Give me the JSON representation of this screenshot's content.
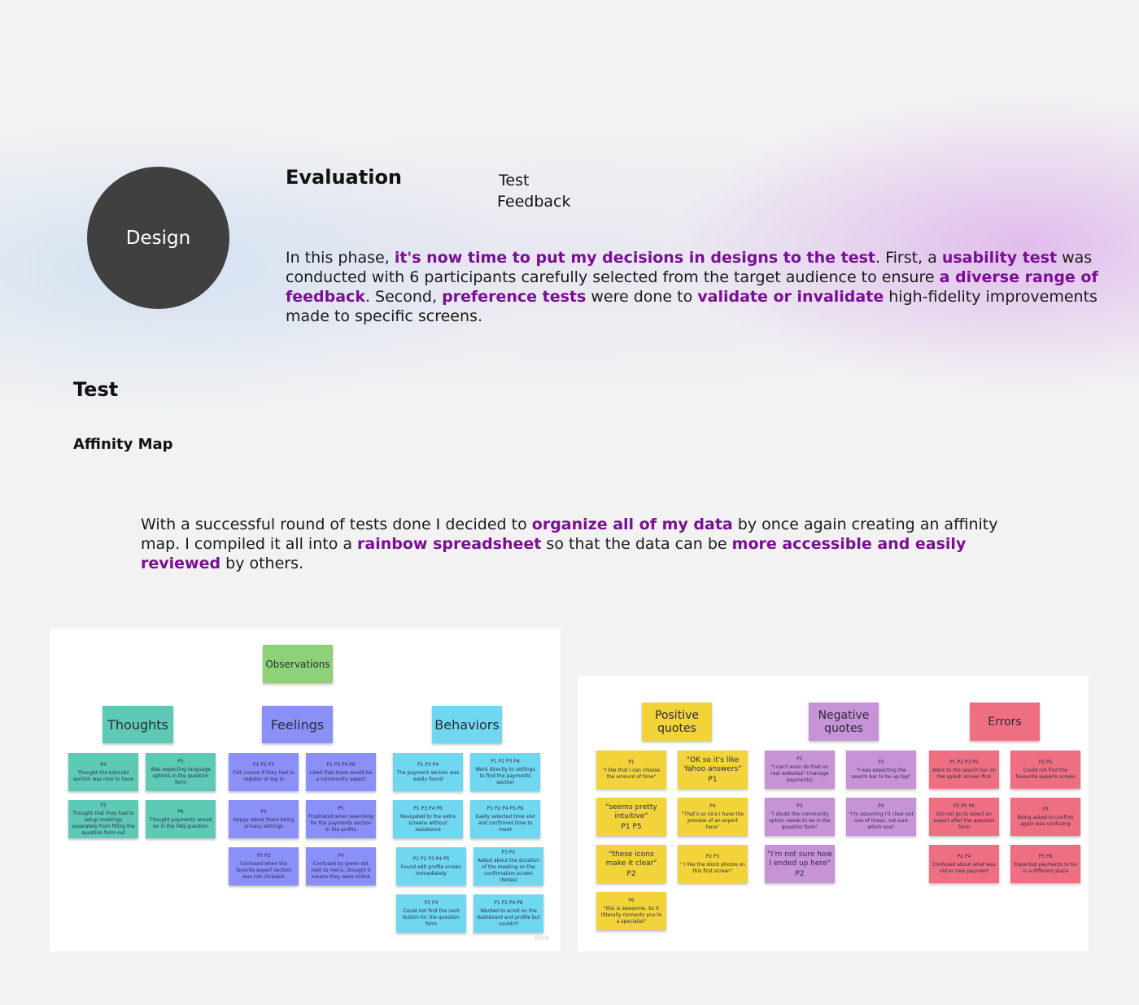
{
  "design_badge": "Design",
  "evaluation": {
    "title": "Evaluation",
    "tags": [
      "Test",
      "Feedback"
    ],
    "body": [
      {
        "text": "In this phase, ",
        "hl": false
      },
      {
        "text": "it's now time to put my decisions in designs to the test",
        "hl": true
      },
      {
        "text": ". First, a ",
        "hl": false
      },
      {
        "text": "usability test",
        "hl": true
      },
      {
        "text": " was conducted with 6 participants carefully selected from the target audience to ensure ",
        "hl": false
      },
      {
        "text": "a diverse range of feedback",
        "hl": true
      },
      {
        "text": ". Second, ",
        "hl": false
      },
      {
        "text": "preference tests",
        "hl": true
      },
      {
        "text": " were done to ",
        "hl": false
      },
      {
        "text": "validate or invalidate",
        "hl": true
      },
      {
        "text": " high-fidelity improvements made to specific screens.",
        "hl": false
      }
    ]
  },
  "test_title": "Test",
  "affinity": {
    "title": "Affinity Map",
    "body": [
      {
        "text": "With a successful round of tests done I decided to ",
        "hl": false
      },
      {
        "text": "organize all of my data",
        "hl": true
      },
      {
        "text": " by once again creating an affinity map. I compiled it all into a ",
        "hl": false
      },
      {
        "text": "rainbow spreadsheet",
        "hl": true
      },
      {
        "text": " so that the data can be ",
        "hl": false
      },
      {
        "text": "more accessible and easily reviewed",
        "hl": true
      },
      {
        "text": " by others.",
        "hl": false
      }
    ]
  },
  "observations_board": {
    "root": "Observations",
    "watermark": "miro",
    "groups": [
      {
        "title": "Thoughts",
        "notes": [
          {
            "pid": "P4",
            "text": "Thought the tutorials section was nice to have"
          },
          {
            "pid": "P5",
            "text": "Was expecting language options in the question form"
          },
          {
            "pid": "P2",
            "text": "Thought that they had to setup meetings separately from filling the question form out"
          },
          {
            "pid": "P6",
            "text": "Thought payments would be in the FAQ question"
          }
        ]
      },
      {
        "title": "Feelings",
        "notes": [
          {
            "pid": "P1 P2 P3",
            "text": "Felt unsure if they had to register or log in"
          },
          {
            "pid": "P1 P3 P4 P6",
            "text": "Liked that there would be a community aspect"
          },
          {
            "pid": "P4",
            "text": "Happy about there being privacy settings"
          },
          {
            "pid": "P5",
            "text": "Frustrated when searching for the payments section in the profile"
          },
          {
            "pid": "P5 P2",
            "text": "Confused when the favorite expert section was not clickable"
          },
          {
            "pid": "P4",
            "text": "Confused by green dot next to menu, thought it means they were online"
          }
        ]
      },
      {
        "title": "Behaviors",
        "notes": [
          {
            "pid": "P1 P3 P4",
            "text": "The payment section was easily found"
          },
          {
            "pid": "P1 P2 P3 P4",
            "text": "Went directly to settings to find the payments section"
          },
          {
            "pid": "P1 P3 P4 P6",
            "text": "Navigated to the extra screens without assistance"
          },
          {
            "pid": "P1 P2 P4 P5 P6",
            "text": "Easily selected time slot and confirmed time to meet"
          },
          {
            "pid": "P1 P2 P3 P4 P5",
            "text": "Found edit profile screen immediately"
          },
          {
            "pid": "P3 P5",
            "text": "Asked about the duration of the meeting on the confirmation screen (Notes)"
          },
          {
            "pid": "P2 P4",
            "text": "Could not find the next button for the question form"
          },
          {
            "pid": "P1 P2 P4 P6",
            "text": "Wanted to scroll on the dashboard and profile but couldn't"
          }
        ]
      }
    ]
  },
  "quotes_board": {
    "groups": [
      {
        "title": "Positive quotes",
        "notes": [
          {
            "pid": "P1",
            "text": "\"I like that I can choose the amount of time\""
          },
          {
            "pid": "P1",
            "text": "\"OK so it's like Yahoo answers\""
          },
          {
            "pid": "P1 P5",
            "text": "\"seems pretty intuitive\""
          },
          {
            "pid": "P4",
            "text": "\"That's so nice I have the preview of an expert here\""
          },
          {
            "pid": "P2",
            "text": "\"these icons make it clear\""
          },
          {
            "pid": "P2 P3",
            "text": "\" I like the stock photos on this first screen\""
          },
          {
            "pid": "P6",
            "text": "\"this is awesome. So it litterally connects you to a specialist\""
          }
        ]
      },
      {
        "title": "Negative quotes",
        "notes": [
          {
            "pid": "P1",
            "text": "\"I can't even do that on real websites\" (manage payments)"
          },
          {
            "pid": "P3",
            "text": "\"I was expecting the search bar to be up top\""
          },
          {
            "pid": "P3",
            "text": "\"I doubt the community option needs to be in the question form\""
          },
          {
            "pid": "P4",
            "text": "\"I'm assuming I'll clear out one of these, not sure which one\""
          },
          {
            "pid": "P2",
            "text": "\"I'm not sure how I ended up here\""
          }
        ]
      },
      {
        "title": "Errors",
        "notes": [
          {
            "pid": "P1 P2 P3 P5",
            "text": "Went to the search bar on the splash screen first"
          },
          {
            "pid": "P2 P5",
            "text": "Could not find the favourite experts screen"
          },
          {
            "pid": "P2 P5 P6",
            "text": "Did not go to select an expert after the question form"
          },
          {
            "pid": "P3",
            "text": "Being asked to confirm again was confusing"
          },
          {
            "pid": "P2 P4",
            "text": "Confused about what was old or new payment"
          },
          {
            "pid": "P5 P6",
            "text": "Expected payments to be in a different place"
          }
        ]
      }
    ]
  },
  "colors": {
    "highlight": "#7a0e94",
    "circle": "#404040",
    "observations": "#8fd179",
    "thoughts": "#5ecab6",
    "feelings": "#8a90f7",
    "behaviors": "#6fd7f0",
    "positive": "#f2d33a",
    "negative": "#c792d6",
    "errors": "#ef6f82"
  }
}
